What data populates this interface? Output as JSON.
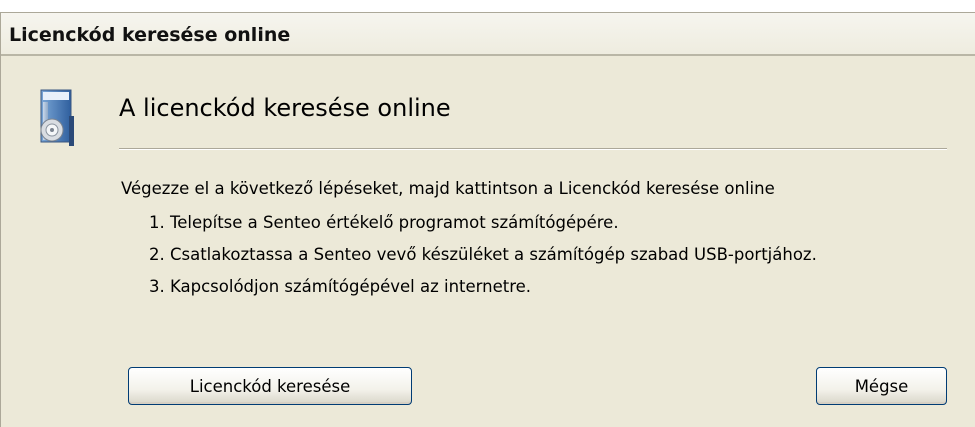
{
  "window": {
    "title": "Licenckód keresése online"
  },
  "header": {
    "icon": "disc-box-icon",
    "title": "A licenckód keresése online"
  },
  "body": {
    "instruction": "Végezze el a következő lépéseket, majd kattintson a Licenckód keresése online",
    "steps": [
      "1. Telepítse a Senteo értékelő programot számítógépére.",
      "2. Csatlakoztassa a Senteo vevő készüléket a számítógép szabad USB-portjához.",
      "3. Kapcsolódjon számítógépével az internetre."
    ]
  },
  "buttons": {
    "search_label": "Licenckód keresése",
    "cancel_label": "Mégse"
  },
  "colors": {
    "dialog_background": "#ece9d8",
    "button_border": "#003c74"
  }
}
